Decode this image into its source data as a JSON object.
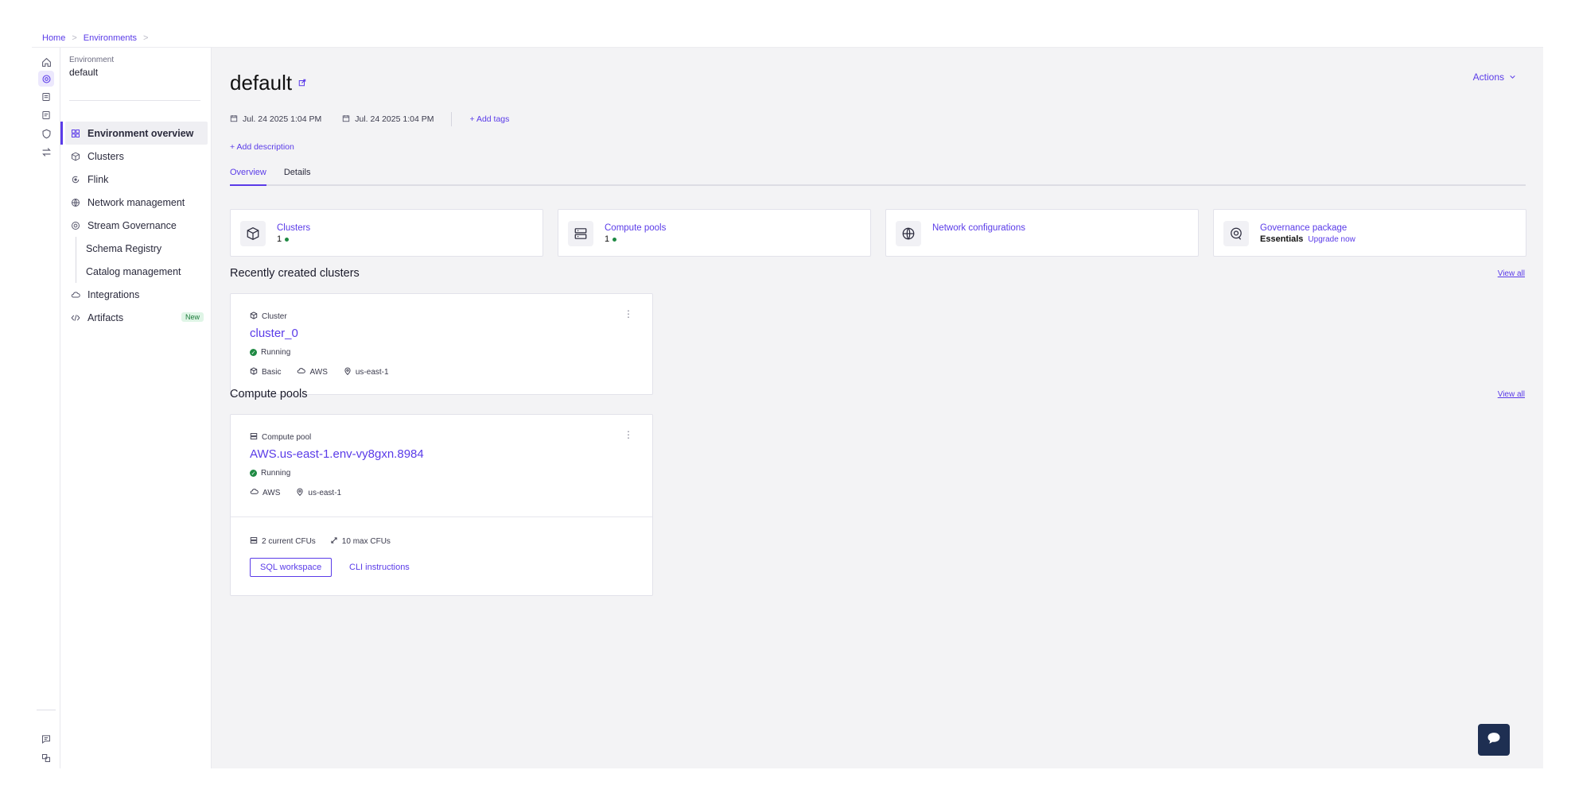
{
  "breadcrumb": {
    "home": "Home",
    "environments": "Environments",
    "sep": ">"
  },
  "sidebar": {
    "env_label": "Environment",
    "env_name": "default",
    "items": [
      {
        "label": "Environment overview",
        "icon": "grid-icon"
      },
      {
        "label": "Clusters",
        "icon": "cube-icon"
      },
      {
        "label": "Flink",
        "icon": "flink-icon"
      },
      {
        "label": "Network management",
        "icon": "globe-icon"
      },
      {
        "label": "Stream Governance",
        "icon": "governance-icon"
      },
      {
        "label": "Schema Registry"
      },
      {
        "label": "Catalog management"
      },
      {
        "label": "Integrations",
        "icon": "cloud-icon"
      },
      {
        "label": "Artifacts",
        "icon": "code-icon",
        "badge": "New"
      }
    ]
  },
  "header": {
    "title": "default",
    "actions": "Actions",
    "created": "Jul. 24 2025 1:04 PM",
    "updated": "Jul. 24 2025 1:04 PM",
    "add_tags": "+ Add tags",
    "add_description": "+ Add description"
  },
  "tabs": [
    "Overview",
    "Details"
  ],
  "summary": [
    {
      "title": "Clusters",
      "value": "1"
    },
    {
      "title": "Compute pools",
      "value": "1"
    },
    {
      "title": "Network configurations",
      "value": ""
    },
    {
      "title": "Governance package",
      "value": "Essentials",
      "link": "Upgrade now"
    }
  ],
  "recent_clusters": {
    "title": "Recently created clusters",
    "view_all": "View all",
    "card": {
      "kind": "Cluster",
      "name": "cluster_0",
      "status": "Running",
      "type": "Basic",
      "cloud": "AWS",
      "region": "us-east-1"
    }
  },
  "compute_pools": {
    "title": "Compute pools",
    "view_all": "View all",
    "card": {
      "kind": "Compute pool",
      "name": "AWS.us-east-1.env-vy8gxn.8984",
      "status": "Running",
      "cloud": "AWS",
      "region": "us-east-1",
      "current_cfus": "2 current CFUs",
      "max_cfus": "10 max CFUs",
      "sql_button": "SQL workspace",
      "cli_link": "CLI instructions"
    }
  },
  "colors": {
    "accent": "#5a3be8",
    "running": "#1f8a43",
    "chat": "#1e2f52"
  }
}
